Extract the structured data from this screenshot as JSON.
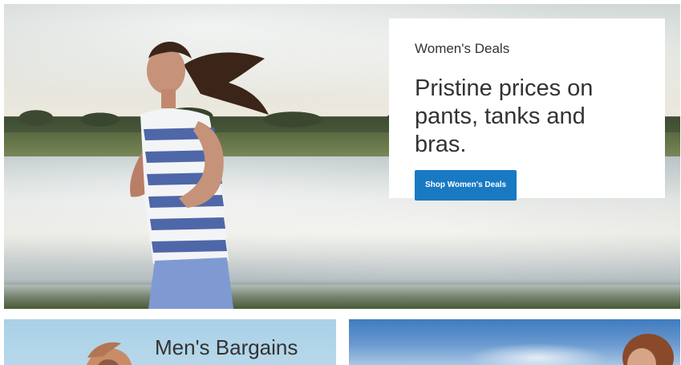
{
  "hero": {
    "promo": {
      "eyebrow": "Women's Deals",
      "headline": "Pristine prices on pants, tanks and bras.",
      "button_label": "Shop Women's Deals"
    },
    "image_subject": "woman-running-by-lake"
  },
  "tiles": [
    {
      "title": "Men's Bargains",
      "image_subject": "man-stretching"
    },
    {
      "title": "",
      "image_subject": "woman-sky"
    }
  ],
  "colors": {
    "button_bg": "#1979c3",
    "button_text": "#ffffff",
    "card_bg": "#ffffff",
    "text_dark": "#333333"
  }
}
